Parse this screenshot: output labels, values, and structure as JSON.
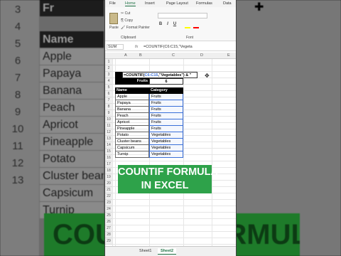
{
  "background": {
    "row_numbers": [
      "3",
      "4",
      "5",
      "6",
      "7",
      "8",
      "9",
      "10",
      "11",
      "12",
      "13"
    ],
    "header_fragment": "Fr",
    "name_header": "Name",
    "names": [
      "Apple",
      "Papaya",
      "Banana",
      "Peach",
      "Apricot",
      "Pineapple",
      "Potato",
      "Cluster beans",
      "Capsicum",
      "Turnip"
    ],
    "big_banner_text": "COUNTIF FORMULA"
  },
  "ribbon": {
    "tabs": [
      "File",
      "Home",
      "Insert",
      "Page Layout",
      "Formulas",
      "Data"
    ],
    "active_tab": "Home",
    "paste_label": "Paste",
    "cut_label": "Cut",
    "copy_label": "Copy",
    "format_painter_label": "Format Painter",
    "clipboard_group": "Clipboard",
    "font_group": "Font",
    "bold": "B",
    "italic": "I",
    "underline": "U"
  },
  "formula_bar": {
    "name_box": "SUM",
    "fx_label": "fx",
    "formula": "=COUNTIF(C6:C15,\"Vegeta"
  },
  "columns": [
    "A",
    "B",
    "C",
    "D",
    "E"
  ],
  "rows": [
    "1",
    "2",
    "3",
    "4",
    "5",
    "6",
    "7",
    "8",
    "9",
    "10",
    "11",
    "12",
    "13",
    "14",
    "15",
    "16",
    "17",
    "18",
    "19",
    "20",
    "21",
    "22",
    "23",
    "24",
    "25",
    "26",
    "27",
    "28",
    "29"
  ],
  "lookup": {
    "row3_label": "Ve",
    "formula_edit_prefix": "=COUNTIF(",
    "formula_edit_ref": "C6:C15",
    "formula_edit_suffix": ",\"Vegetables\") & \"",
    "row4_label": "Fruits",
    "row4_value": "6"
  },
  "table": {
    "header_name": "Name",
    "header_category": "Category",
    "rows": [
      {
        "name": "Apple",
        "category": "Fruits"
      },
      {
        "name": "Papaya",
        "category": "Fruits"
      },
      {
        "name": "Banana",
        "category": "Fruits"
      },
      {
        "name": "Peach",
        "category": "Fruits"
      },
      {
        "name": "Apricot",
        "category": "Fruits"
      },
      {
        "name": "Pineapple",
        "category": "Fruits"
      },
      {
        "name": "Potato",
        "category": "Vegetables"
      },
      {
        "name": "Cluster beans",
        "category": "Vegetables"
      },
      {
        "name": "Capsicum",
        "category": "Vegetables"
      },
      {
        "name": "Turnip",
        "category": "Vegetables"
      }
    ]
  },
  "sheets": [
    "Sheet1",
    "Sheet2"
  ],
  "active_sheet": "Sheet2",
  "banner": {
    "line1": "COUNTIF FORMULA",
    "line2": "IN EXCEL"
  },
  "colors": {
    "banner_green": "#2ea24a",
    "excel_green": "#217346",
    "selection_blue": "#3a6fd8"
  }
}
